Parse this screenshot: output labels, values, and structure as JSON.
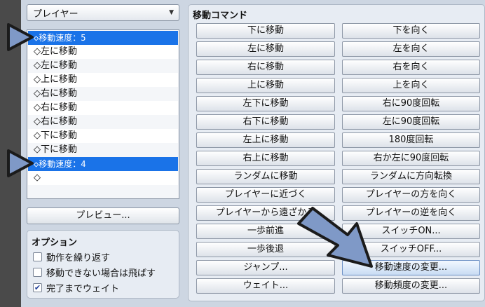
{
  "target_select": {
    "value": "プレイヤー",
    "caret": "▼"
  },
  "route_list": [
    "◇移動速度：5",
    "◇左に移動",
    "◇左に移動",
    "◇上に移動",
    "◇右に移動",
    "◇右に移動",
    "◇右に移動",
    "◇下に移動",
    "◇下に移動",
    "◇移動速度：4",
    "◇"
  ],
  "preview_label": "プレビュー...",
  "options": {
    "title": "オプション",
    "items": [
      {
        "label": "動作を繰り返す",
        "checked": false
      },
      {
        "label": "移動できない場合は飛ばす",
        "checked": false
      },
      {
        "label": "完了までウェイト",
        "checked": true
      }
    ]
  },
  "commands": {
    "title": "移動コマンド",
    "left": [
      "下に移動",
      "左に移動",
      "右に移動",
      "上に移動",
      "左下に移動",
      "右下に移動",
      "左上に移動",
      "右上に移動",
      "ランダムに移動",
      "プレイヤーに近づく",
      "プレイヤーから遠ざかる",
      "一歩前進",
      "一歩後退",
      "ジャンプ...",
      "ウェイト..."
    ],
    "right": [
      "下を向く",
      "左を向く",
      "右を向く",
      "上を向く",
      "右に90度回転",
      "左に90度回転",
      "180度回転",
      "右か左に90度回転",
      "ランダムに方向転換",
      "プレイヤーの方を向く",
      "プレイヤーの逆を向く",
      "スイッチON...",
      "スイッチOFF...",
      "移動速度の変更...",
      "移動頻度の変更..."
    ]
  },
  "colors": {
    "selection": "#1a73e8",
    "annotation_fill": "#7f99c7",
    "annotation_stroke": "#1b1b1b"
  }
}
